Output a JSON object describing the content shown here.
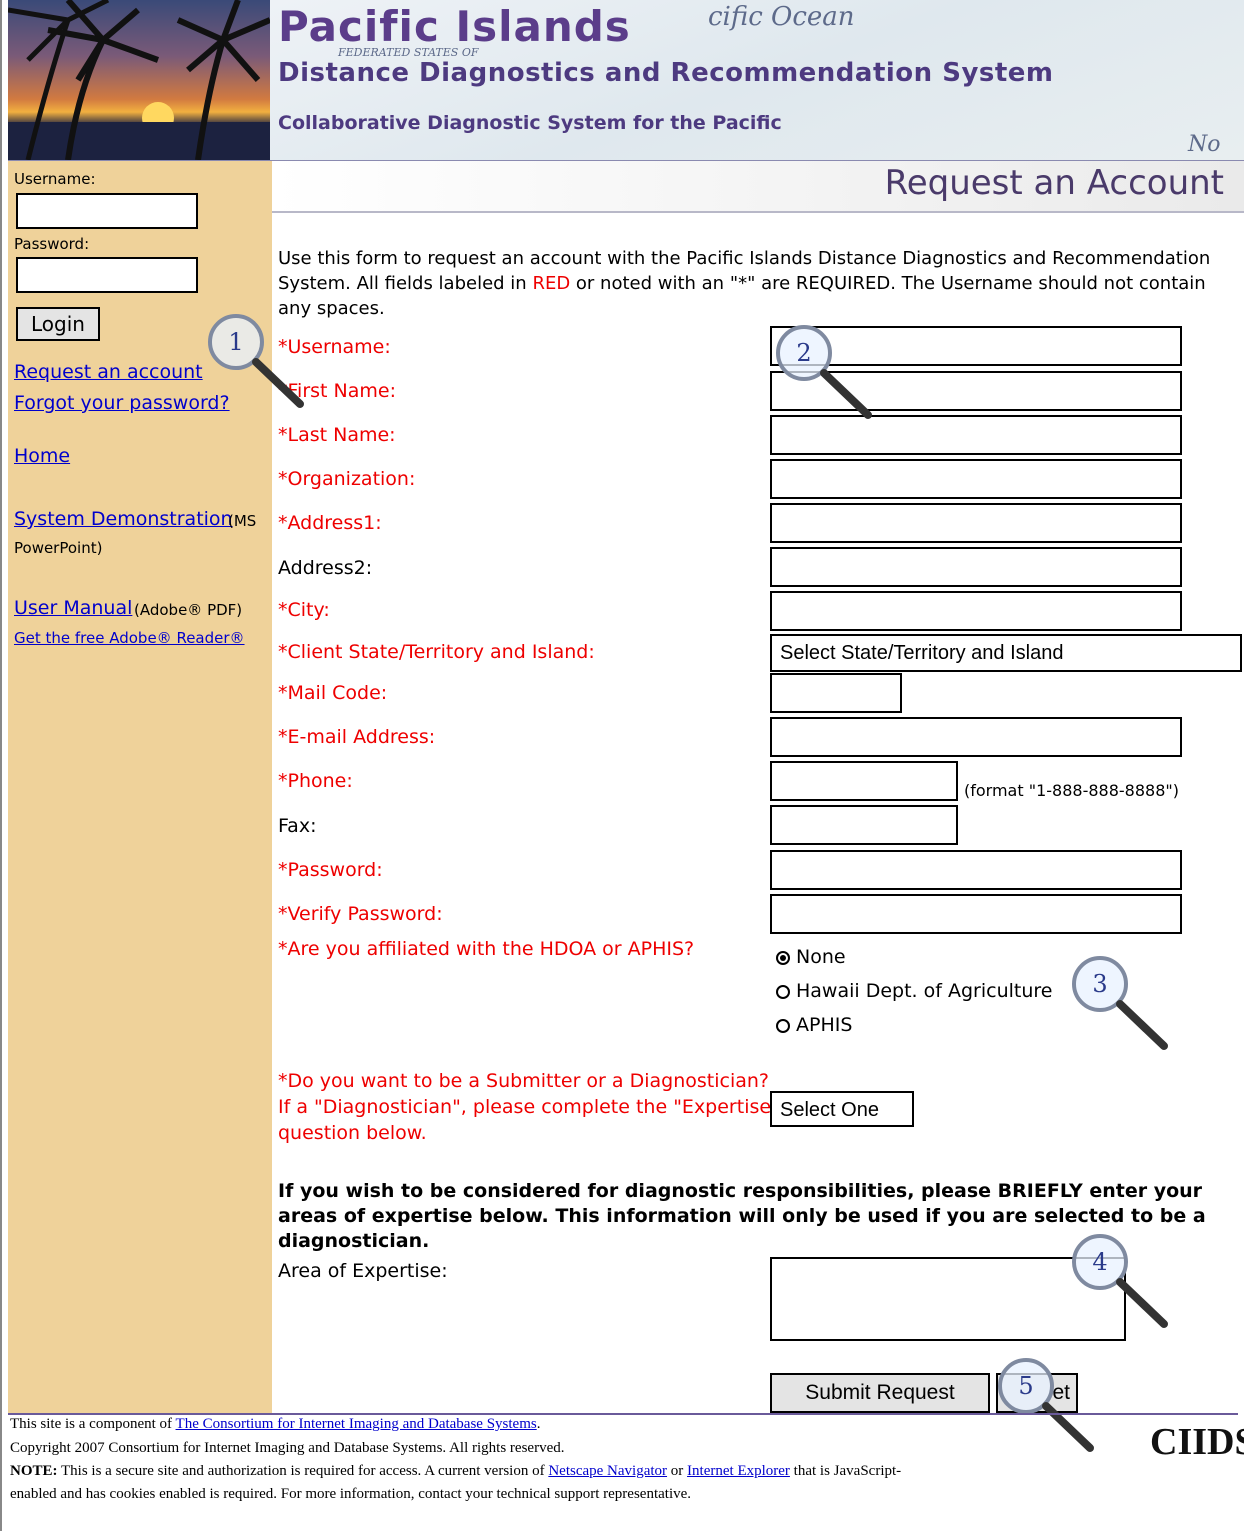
{
  "header": {
    "title": "Pacific Islands",
    "subtitle": "Distance Diagnostics and Recommendation System",
    "tagline": "Collaborative Diagnostic System for the Pacific",
    "map_text_ocean": "cific Ocean",
    "map_text_states": "FEDERATED STATES OF",
    "map_text_no": "No"
  },
  "sidebar": {
    "username_label": "Username:",
    "password_label": "Password:",
    "login_label": "Login",
    "request_link": "Request an account",
    "forgot_link": "Forgot your password?",
    "home_link": "Home",
    "demo_link": "System Demonstration",
    "demo_note_1": "(MS",
    "demo_note_2": "PowerPoint)",
    "manual_link": "User Manual",
    "manual_note": "(Adobe® PDF)",
    "reader_link": "Get the free Adobe® Reader®"
  },
  "page": {
    "title": "Request an Account",
    "intro_1": "Use this form to request an account with the Pacific Islands Distance Diagnostics and Recommendation System. All fields labeled in ",
    "intro_red": "RED",
    "intro_2": " or noted with an \"*\" are REQUIRED. The Username should not contain any spaces."
  },
  "form": {
    "username": "*Username:",
    "first_name": "*First Name:",
    "last_name": "*Last Name:",
    "organization": "*Organization:",
    "address1": "*Address1:",
    "address2": "Address2:",
    "city": "*City:",
    "state": "*Client State/Territory and Island:",
    "state_select": "Select State/Territory and Island",
    "mail_code": "*Mail Code:",
    "email": "*E-mail Address:",
    "phone": "*Phone:",
    "phone_hint": "(format \"1-888-888-8888\")",
    "fax": "Fax:",
    "password": "*Password:",
    "verify_password": "*Verify Password:",
    "affiliation": "*Are you affiliated with the HDOA or APHIS?",
    "affiliation_options": [
      "None",
      "Hawaii Dept. of Agriculture",
      "APHIS"
    ],
    "affiliation_selected": "None",
    "role_q1": "*Do you want to be a Submitter or a Diagnostician?",
    "role_q2": "If a \"Diagnostician\", please complete the \"Expertise\"",
    "role_q3": "question below.",
    "role_select": "Select One",
    "expertise_note": "If you wish to be considered for diagnostic responsibilities, please BRIEFLY enter your areas of expertise below. This information will only be used if you are selected to be a diagnostician.",
    "expertise_label": "Area of Expertise:",
    "submit_label": "Submit Request",
    "reset_label": "Reset",
    "reset_visible": "et"
  },
  "annotations": [
    "1",
    "2",
    "3",
    "4",
    "5"
  ],
  "footer": {
    "line1_prefix": "This site is a component of ",
    "line1_link": "The Consortium for Internet Imaging and Database Systems",
    "line1_suffix": ".",
    "line2": "Copyright 2007 Consortium for Internet Imaging and Database Systems. All rights reserved.",
    "note_bold": "NOTE:",
    "note_1": " This is a secure site and authorization is required for access. A current version of ",
    "netscape": "Netscape Navigator",
    "or": " or ",
    "ie": "Internet Explorer",
    "note_2": " that is JavaScript-",
    "line4": "enabled and has cookies enabled is required. For more information, contact your technical support representative.",
    "logo": "CIIDS"
  },
  "colors": {
    "sidebar_bg": "#efd29a",
    "required_red": "#ee0000",
    "link_blue": "#0000cc",
    "title_purple": "#5b3d8a"
  }
}
